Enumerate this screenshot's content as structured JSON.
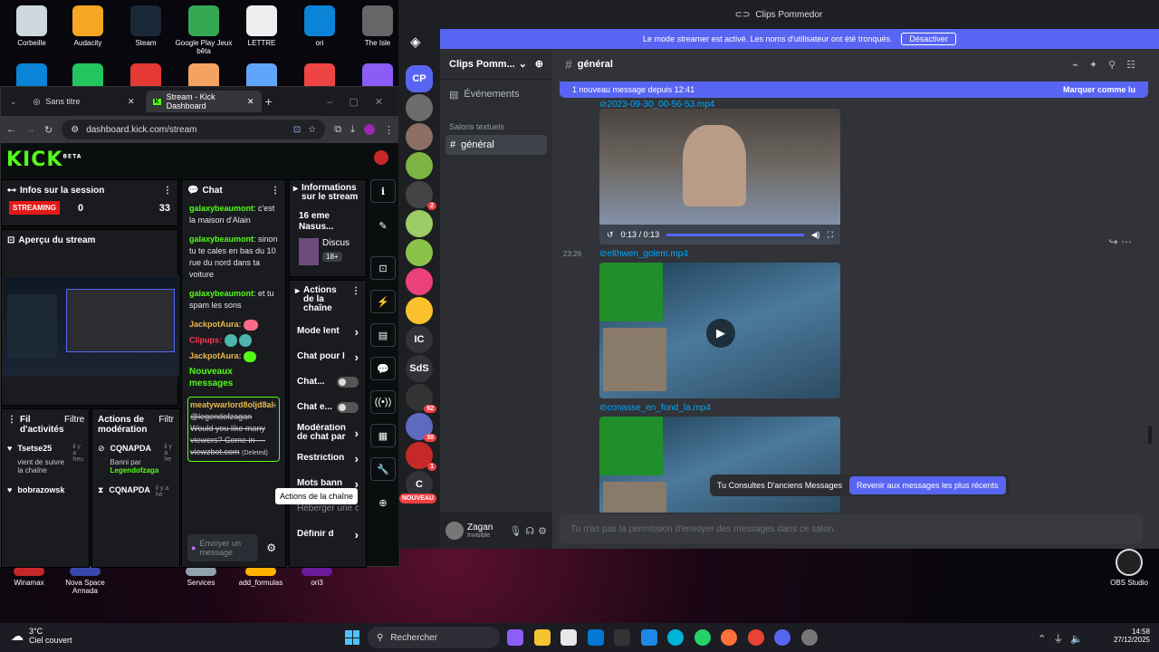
{
  "desktop": {
    "icons_top": [
      {
        "label": "Corbeille",
        "color": "#cfd8dc"
      },
      {
        "label": "Audacity",
        "color": "#f5a623"
      },
      {
        "label": "Steam",
        "color": "#1b2838"
      },
      {
        "label": "Google Play Jeux bêta",
        "color": "#34a853"
      },
      {
        "label": "LETTRE",
        "color": "#eeeeee"
      },
      {
        "label": "ori",
        "color": "#0b84d8"
      },
      {
        "label": "The Isle",
        "color": "#666666"
      }
    ],
    "icons_bottom": [
      {
        "label": "Winamax",
        "color": "#c62828"
      },
      {
        "label": "Nova Space Armada",
        "color": "#3949ab"
      },
      {
        "label": "Services",
        "color": "#90a4ae"
      },
      {
        "label": "add_formulas",
        "color": "#ffb300"
      },
      {
        "label": "ori3",
        "color": "#6a1b9a"
      }
    ],
    "obs_label": "OBS Studio"
  },
  "browser": {
    "tabs": [
      {
        "label": "Sans titre"
      },
      {
        "label": "Stream - Kick Dashboard"
      }
    ],
    "url": "dashboard.kick.com/stream",
    "kick": {
      "logo": "KICK",
      "beta": "BETA",
      "session": {
        "title": "Infos sur la session",
        "status": "STREAMING",
        "count1": "0",
        "count2": "33"
      },
      "preview_title": "Aperçu du stream",
      "activity": {
        "title": "Fil d'activités",
        "filter": "Filtre",
        "items": [
          {
            "name": "Tsetse25",
            "sub": "vient de suivre la chaîne",
            "time": "il y a heu"
          },
          {
            "name": "bobrazowsk",
            "sub": "",
            "time": ""
          }
        ]
      },
      "moderation": {
        "title": "Actions de modération",
        "filter": "Filtr",
        "items": [
          {
            "name": "CQNAPDA",
            "sub": "Banni par",
            "by": "Legendofzaga",
            "time": "il y a he"
          },
          {
            "name": "CQNAPDA",
            "sub": "",
            "by": "",
            "time": "il y a he"
          }
        ]
      },
      "chat": {
        "title": "Chat",
        "messages": [
          {
            "user": "galaxybeaumont",
            "text": ": c'est la maison d'Alain"
          },
          {
            "user": "galaxybeaumont",
            "text": ": sinon tu te cales en bas du 10 rue du nord dans ta voiture"
          },
          {
            "user": "galaxybeaumont",
            "text": ": et tu spam les sons"
          }
        ],
        "jackpot": "JackpotAura:",
        "clipups": "Clipups:",
        "new_messages": "Nouveaux messages",
        "deleted_user": "meatywarlord8oljd8al",
        "deleted_text": ": @legendofzagan Would you like many viewers? Come in — viewzbot.com",
        "deleted_tag": "(Deleted)",
        "input_placeholder": "Envoyer un message"
      },
      "info": {
        "title": "Informations sur le stream",
        "stream_title": "16 eme Nasus...",
        "category": "Discus",
        "rating": "18+"
      },
      "actions": {
        "title": "Actions de la chaîne",
        "items": [
          {
            "label": "Mode lent"
          },
          {
            "label": "Chat pour l"
          },
          {
            "label": "Chat..."
          },
          {
            "label": "Chat e..."
          },
          {
            "label": "Modération de chat par"
          },
          {
            "label": "Restriction"
          },
          {
            "label": "Mots bann"
          },
          {
            "label": "Héberger une ch"
          },
          {
            "label": "Définir d"
          }
        ],
        "tooltip": "Actions de la chaîne"
      }
    }
  },
  "discord": {
    "window_title": "Clips Pommedor",
    "streamer_banner": "Le mode streamer est activé. Les noms d'utilisateur ont été tronqués.",
    "streamer_button": "Désactiver",
    "server_name": "Clips Pomm...",
    "events": "Événements",
    "category": "Salons textuels",
    "channel": "général",
    "channel_header": "général",
    "new_msg_bar": "1 nouveau message depuis 12:41",
    "mark_read": "Marquer comme lu",
    "attachments": [
      {
        "name": "2023-09-30_00-56-53.mp4",
        "time": "0:13 / 0:13"
      },
      {
        "name": "elthwen_golem.mp4",
        "timestamp": "23:26"
      },
      {
        "name": "conasse_en_fond_la.mp4"
      }
    ],
    "old_msgs": "Tu Consultes D'anciens Messages",
    "jump": "Revenir aux messages les plus récents",
    "no_perm": "Tu n'as pas la permission d'envoyer des messages dans ce salon.",
    "user": {
      "name": "Zagan",
      "status": "Invisible"
    },
    "guilds": [
      {
        "label": "CP",
        "color": "#5865f2"
      },
      {
        "label": "",
        "color": "#6d6d6d"
      },
      {
        "label": "",
        "color": "#8d6e63"
      },
      {
        "label": "",
        "color": "#7cb342"
      },
      {
        "label": "",
        "color": "#444444",
        "badge": "2"
      },
      {
        "label": "",
        "color": "#9ccc65"
      },
      {
        "label": "",
        "color": "#8bc34a"
      },
      {
        "label": "",
        "color": "#ec407a"
      },
      {
        "label": "",
        "color": "#fbc02d"
      },
      {
        "label": "IC",
        "color": "#313338"
      },
      {
        "label": "SdS",
        "color": "#313338"
      },
      {
        "label": "",
        "color": "#333333",
        "badge": "92"
      },
      {
        "label": "",
        "color": "#5c6bc0",
        "badge": "39"
      },
      {
        "label": "",
        "color": "#c62828",
        "badge": "1"
      },
      {
        "label": "C",
        "color": "#313338"
      }
    ],
    "new_badge": "NOUVEAU"
  },
  "taskbar": {
    "weather_temp": "3°C",
    "weather_text": "Ciel couvert",
    "search": "Rechercher",
    "time": "14:58",
    "date": "27/12/2025"
  }
}
